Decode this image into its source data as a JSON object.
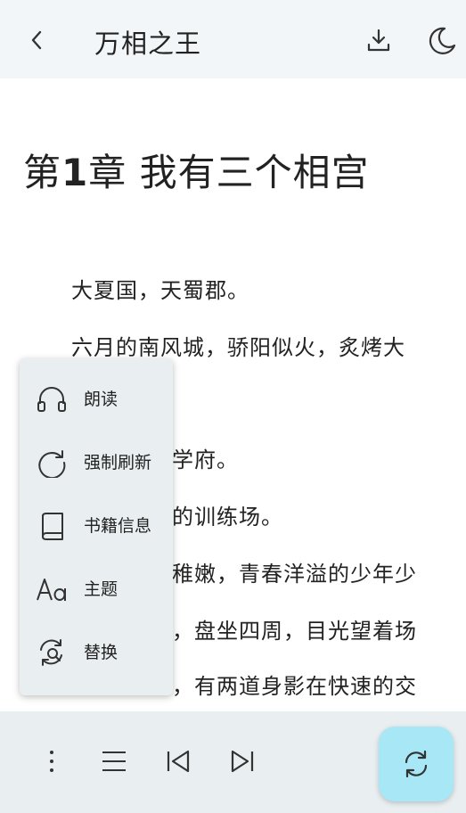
{
  "header": {
    "book_title": "万相之王"
  },
  "chapter": {
    "number_prefix": "第",
    "number": "1",
    "number_suffix": "章",
    "name": "我有三个相宫"
  },
  "paragraphs": [
    "大夏国，天蜀郡。",
    "六月的南风城，骄阳似火，炙烤大",
    "学府。",
    "的训练场。",
    "稚嫩，青春洋溢的少年少",
    "，盘坐四周，目光望着场",
    "，有两道身影在快速的交"
  ],
  "menu": {
    "items": [
      {
        "label": "朗读",
        "icon": "headphones-icon"
      },
      {
        "label": "强制刷新",
        "icon": "refresh-icon"
      },
      {
        "label": "书籍信息",
        "icon": "book-icon"
      },
      {
        "label": "主题",
        "icon": "font-icon"
      },
      {
        "label": "替换",
        "icon": "replace-icon"
      }
    ]
  },
  "bottom_bar": {
    "buttons": [
      "more-vertical-icon",
      "list-icon",
      "skip-previous-icon",
      "skip-next-icon"
    ],
    "fab_icon": "sync-icon"
  },
  "colors": {
    "header_bg": "#f2f6f9",
    "menu_bg": "#e9eef1",
    "fab_bg": "#a8e7f6"
  }
}
